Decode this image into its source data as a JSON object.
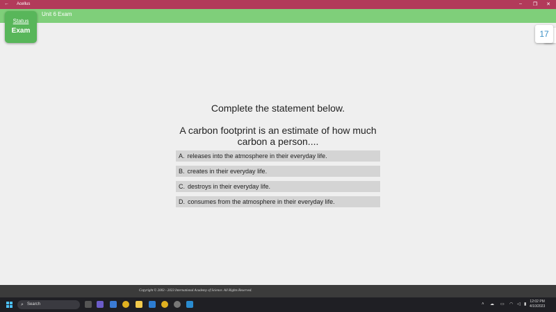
{
  "window": {
    "back_icon": "back-arrow-icon",
    "title": "Acellus",
    "controls": [
      "minimize-icon",
      "restore-icon",
      "close-icon"
    ]
  },
  "header": {
    "exam_title": "Unit 6 Exam",
    "status_link": "Status",
    "mode": "Exam",
    "calendar_day": "17"
  },
  "question": {
    "instruction": "Complete the statement below.",
    "text": "A carbon footprint is an estimate of how much carbon a person....",
    "answers": [
      {
        "letter": "A.",
        "text": "releases into the atmosphere in their everyday life."
      },
      {
        "letter": "B.",
        "text": "creates in their everyday life."
      },
      {
        "letter": "C.",
        "text": "destroys in their everyday life."
      },
      {
        "letter": "D.",
        "text": "consumes from the atmosphere in their everyday life."
      }
    ]
  },
  "footer": {
    "copyright": "Copyright © 2003 - 2023 International Academy of Science.  All Rights Reserved."
  },
  "taskbar": {
    "search_label": "Search",
    "time": "12:02 PM",
    "date": "4/10/2023"
  },
  "colors": {
    "titlebar": "#b23a5a",
    "appbar": "#7fcf7a",
    "badge": "#58b65a",
    "answer_bg": "#d4d4d4"
  }
}
